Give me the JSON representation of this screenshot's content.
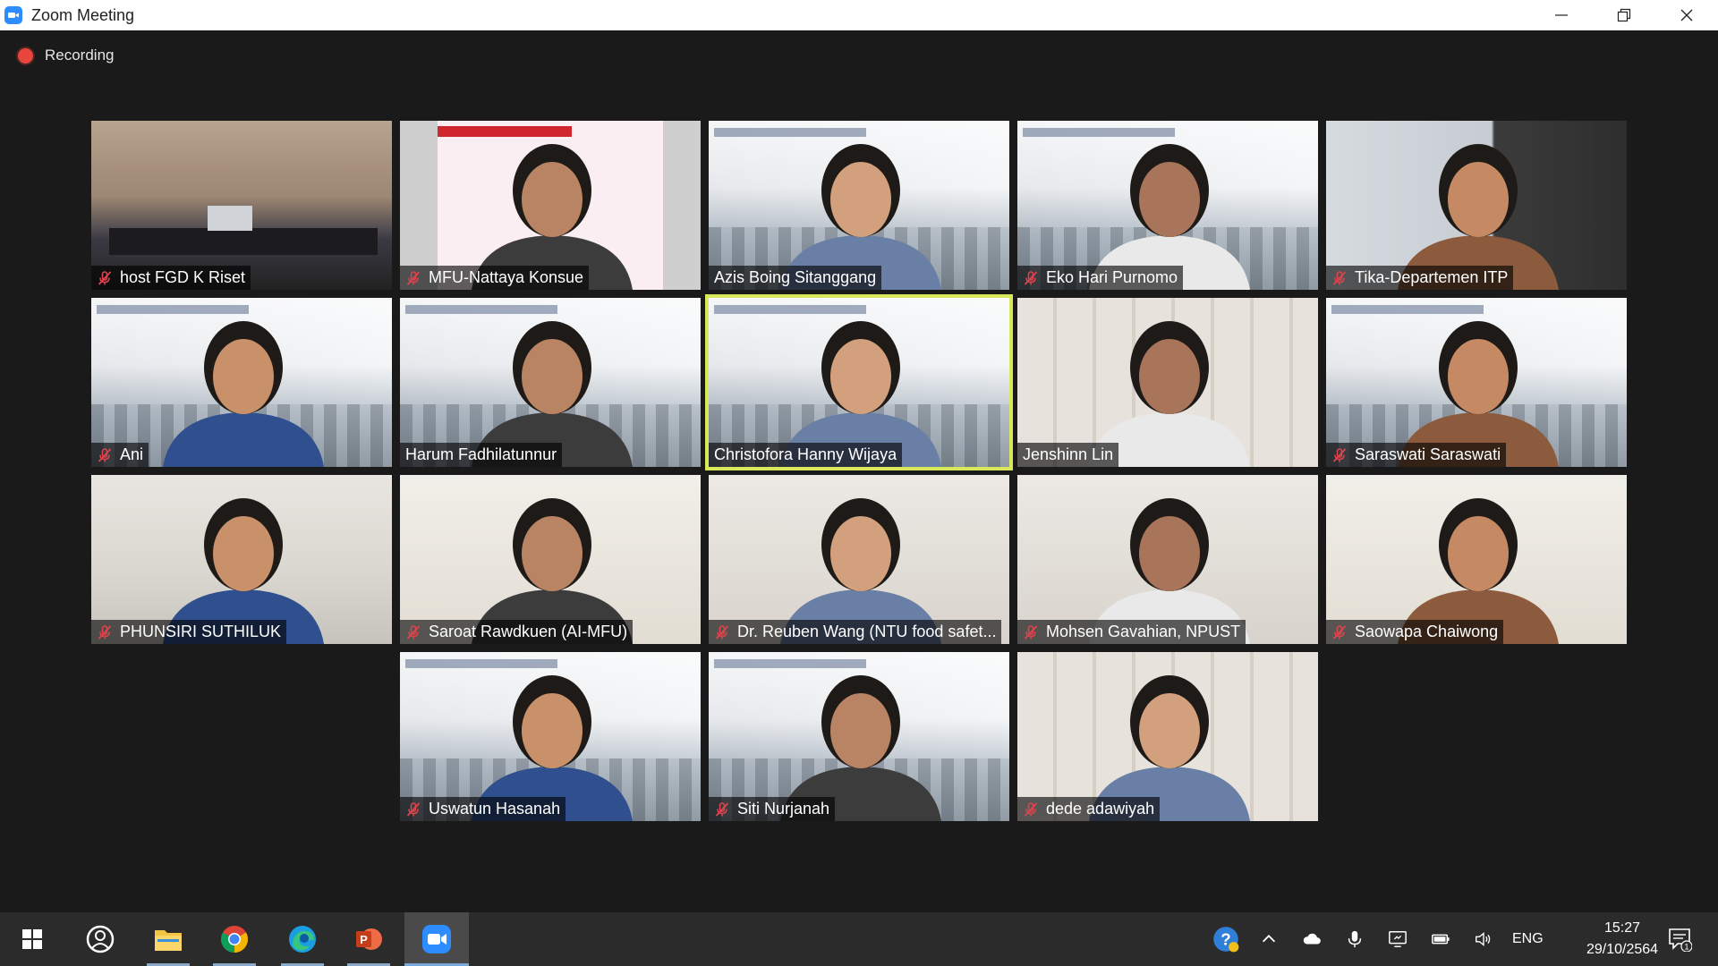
{
  "window": {
    "title": "Zoom Meeting"
  },
  "recording": {
    "label": "Recording"
  },
  "participants": [
    {
      "name": "host FGD K Riset",
      "muted": true,
      "bg": "room"
    },
    {
      "name": "MFU-Nattaya Konsue",
      "muted": true,
      "bg": "slide"
    },
    {
      "name": "Azis Boing Sitanggang",
      "muted": false,
      "bg": "conf"
    },
    {
      "name": "Eko Hari Purnomo",
      "muted": true,
      "bg": "conf"
    },
    {
      "name": "Tika-Departemen ITP",
      "muted": true,
      "bg": "dark-right"
    },
    {
      "name": "Ani",
      "muted": true,
      "bg": "conf"
    },
    {
      "name": "Harum Fadhilatunnur",
      "muted": false,
      "bg": "conf"
    },
    {
      "name": "Christofora Hanny Wijaya",
      "muted": false,
      "bg": "conf",
      "active_speaker": true
    },
    {
      "name": "Jenshinn Lin",
      "muted": false,
      "bg": "blinds"
    },
    {
      "name": "Saraswati Saraswati",
      "muted": true,
      "bg": "conf"
    },
    {
      "name": "PHUNSIRI SUTHILUK",
      "muted": true,
      "bg": "office"
    },
    {
      "name": "Saroat Rawdkuen (AI-MFU)",
      "muted": true,
      "bg": "school"
    },
    {
      "name": "Dr. Reuben Wang (NTU food safet...",
      "muted": true,
      "bg": "wall"
    },
    {
      "name": "Mohsen Gavahian, NPUST",
      "muted": true,
      "bg": "wall"
    },
    {
      "name": "Saowapa Chaiwong",
      "muted": true,
      "bg": "school"
    },
    {
      "name": "Uswatun Hasanah",
      "muted": true,
      "bg": "conf"
    },
    {
      "name": "Siti Nurjanah",
      "muted": true,
      "bg": "conf"
    },
    {
      "name": "dede adawiyah",
      "muted": true,
      "bg": "blinds"
    }
  ],
  "taskbar": {
    "apps": [
      {
        "name": "start-button"
      },
      {
        "name": "cortana"
      },
      {
        "name": "file-explorer"
      },
      {
        "name": "chrome"
      },
      {
        "name": "edge"
      },
      {
        "name": "powerpoint"
      },
      {
        "name": "zoom"
      }
    ],
    "language": "ENG",
    "time": "15:27",
    "date": "29/10/2564",
    "notification_count": "1"
  },
  "colors": {
    "accent_active_speaker": "#d9e85a",
    "recording_dot": "#e8463c",
    "zoom_blue": "#2d8cff",
    "mute_red": "#e0434d"
  }
}
